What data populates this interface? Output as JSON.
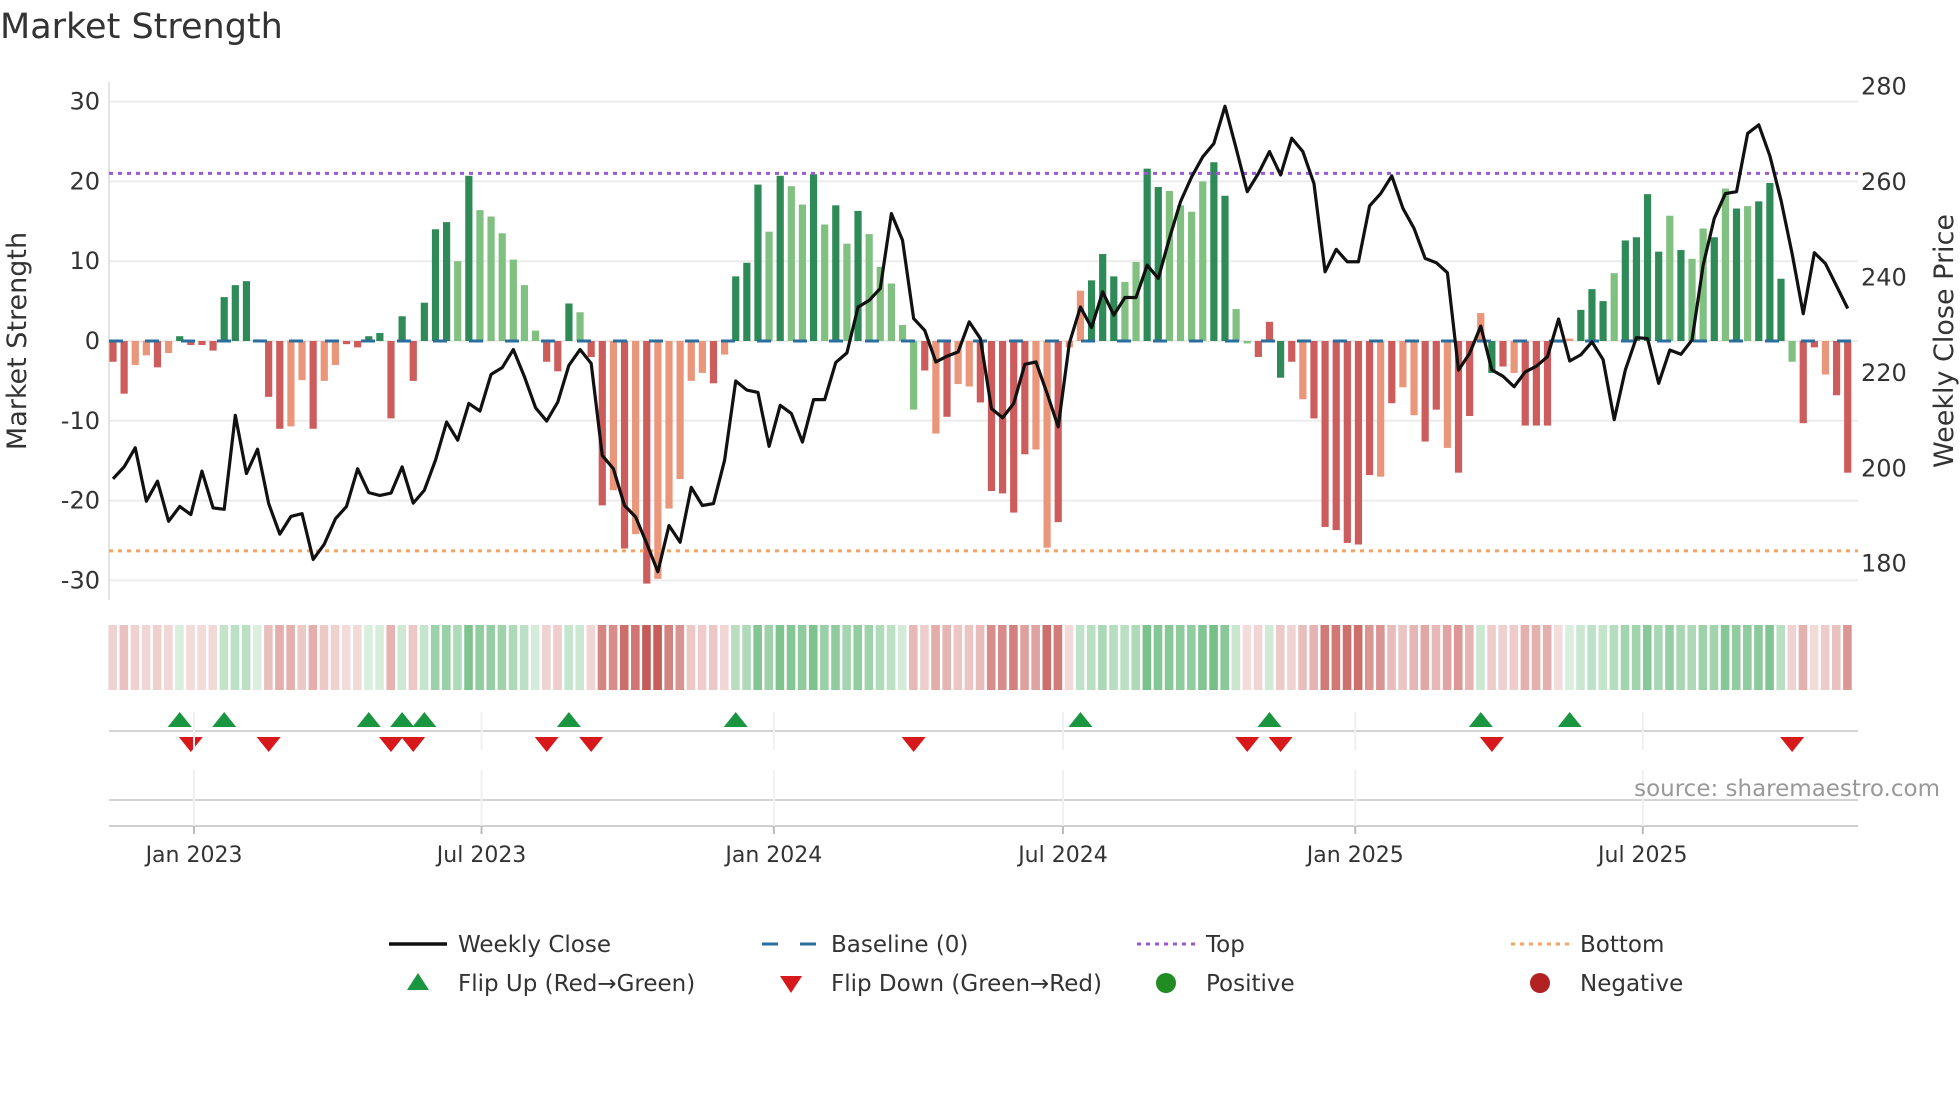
{
  "chart_data": {
    "type": "bar",
    "title": "Market Strength",
    "ylabel": "Market Strength",
    "y2label": "Weekly Close Price",
    "ylim": [
      -32.5,
      33
    ],
    "y2lim": [
      176,
      284
    ],
    "yticks": [
      30,
      20,
      10,
      0,
      -10,
      -20,
      -30
    ],
    "y2ticks": [
      280,
      260,
      240,
      220,
      200,
      180
    ],
    "x_start": "2022-11-11",
    "x_frequency": "weekly",
    "xtick_labels": [
      {
        "date": "2023-01-01",
        "label": "Jan 2023"
      },
      {
        "date": "2023-07-01",
        "label": "Jul 2023"
      },
      {
        "date": "2024-01-01",
        "label": "Jan 2024"
      },
      {
        "date": "2024-07-01",
        "label": "Jul 2024"
      },
      {
        "date": "2025-01-01",
        "label": "Jan 2025"
      },
      {
        "date": "2025-07-01",
        "label": "Jul 2025"
      }
    ],
    "top_level": 21,
    "bottom_level": -26.3,
    "baseline": 0,
    "strength": [
      -2.6,
      -6.6,
      -3,
      -1.8,
      -3.3,
      -1.5,
      0.6,
      -0.5,
      -0.5,
      -1.2,
      5.5,
      7,
      7.5,
      0.2,
      -7,
      -11,
      -10.7,
      -4.9,
      -11,
      -5,
      -3,
      -0.4,
      -0.8,
      0.6,
      1,
      -9.7,
      3.1,
      -5,
      4.8,
      14,
      14.9,
      10,
      20.7,
      16.4,
      15.6,
      13.5,
      10.2,
      7,
      1.3,
      -2.6,
      -3.8,
      4.7,
      3.6,
      -2,
      -20.6,
      -18.7,
      -26,
      -24.2,
      -30.4,
      -29.8,
      -21,
      -17.3,
      -5,
      -4,
      -5.3,
      -1.7,
      8.1,
      9.8,
      19.6,
      13.7,
      20.7,
      19.4,
      17.1,
      20.9,
      14.6,
      17,
      12.2,
      16.3,
      13.4,
      9.3,
      7.2,
      2,
      -8.6,
      -3.7,
      -11.6,
      -9.5,
      -5.4,
      -5.7,
      -7.7,
      -18.8,
      -19.1,
      -21.5,
      -14.2,
      -13.6,
      -25.9,
      -22.7,
      -0.8,
      6.3,
      7.6,
      10.9,
      8.1,
      7.4,
      9.9,
      21.6,
      19.3,
      18.8,
      17,
      16.2,
      20,
      22.4,
      18.2,
      4,
      -0.3,
      -2,
      2.4,
      -4.6,
      -2.6,
      -7.3,
      -9.7,
      -23.3,
      -23.7,
      -25.3,
      -25.5,
      -16.8,
      -17,
      -7.8,
      -5.8,
      -9.3,
      -12.6,
      -8.6,
      -13.4,
      -16.5,
      -9.4,
      3.5,
      -4,
      -3.2,
      -4,
      -10.6,
      -10.6,
      -10.6,
      -0.2,
      0.3,
      3.9,
      6.5,
      5,
      8.5,
      12.6,
      13,
      18.4,
      11.2,
      15.7,
      11.4,
      10.3,
      14.1,
      13,
      19.1,
      16.6,
      16.9,
      17.5,
      19.8,
      7.8,
      -2.6,
      -10.3,
      -0.8,
      -4.2,
      -6.8,
      -16.5
    ],
    "strength_shade": "RRrrRrGRRRGGGgRRrrRrrRRGGRGRGGGgGggggggRRGgRRrRrRrrrrrRrGGGgGggGgGgGgggggRrRrrRRRRRrrRrrGGGggGGggggGGggRRGRrRRRRRRrRrrRRrRRrGRrRRRRrGGGgGGGGgGggGgGgGGGgRRrRRR",
    "close": [
      197.8,
      200.3,
      204.3,
      193.1,
      197.3,
      188.9,
      192,
      190.3,
      199.4,
      191.7,
      191.4,
      211.1,
      198.9,
      204,
      192.6,
      186.2,
      189.9,
      190.5,
      180.9,
      184.1,
      189.4,
      192,
      199.9,
      194.9,
      194.3,
      194.8,
      200.3,
      192.7,
      195.4,
      201.7,
      209.7,
      205.9,
      213.6,
      212,
      219.7,
      221.1,
      224.9,
      219.2,
      212.7,
      209.9,
      213.9,
      221.6,
      224.9,
      222,
      202.7,
      199.9,
      192.2,
      189.8,
      184.2,
      178.3,
      188,
      184.5,
      196,
      192.2,
      192.6,
      201.7,
      218.3,
      216.4,
      215.9,
      204.6,
      213.2,
      211.5,
      205.5,
      214.4,
      214.4,
      222.2,
      224.2,
      233.8,
      235.2,
      237.7,
      253.4,
      247.8,
      231.4,
      228.9,
      222.3,
      223.5,
      224.4,
      230.7,
      227.2,
      212.5,
      210.6,
      213.6,
      221.8,
      222.3,
      215.7,
      208.7,
      226.2,
      233.8,
      229.5,
      237,
      232.1,
      235.8,
      235.8,
      242.6,
      239.8,
      248.2,
      255.9,
      261.1,
      265.3,
      268.1,
      275.9,
      267.1,
      258,
      261.8,
      266.4,
      261.5,
      269.2,
      266.4,
      259.7,
      241.2,
      245.9,
      243.3,
      243.3,
      255,
      257.6,
      261.3,
      254.5,
      250.3,
      244,
      243.1,
      241,
      220.6,
      224.1,
      229.8,
      220.6,
      219.3,
      217.1,
      220.2,
      221.4,
      223.4,
      231.3,
      222.5,
      223.8,
      226.5,
      222.8,
      210.2,
      220.6,
      227.4,
      227.2,
      217.8,
      224.8,
      223.9,
      226.9,
      242.6,
      252.4,
      257.6,
      258,
      270.2,
      272,
      265.5,
      256.2,
      245,
      232.4,
      245.2,
      242.9,
      238.2,
      233.5
    ],
    "legend": {
      "placement": "bottom",
      "items": [
        {
          "key": "close",
          "label": "Weekly Close"
        },
        {
          "key": "baseline",
          "label": "Baseline (0)"
        },
        {
          "key": "top",
          "label": "Top"
        },
        {
          "key": "bottom",
          "label": "Bottom"
        },
        {
          "key": "flip_up",
          "label": "Flip Up (Red→Green)"
        },
        {
          "key": "flip_down",
          "label": "Flip Down (Green→Red)"
        },
        {
          "key": "positive",
          "label": "Positive"
        },
        {
          "key": "negative",
          "label": "Negative"
        }
      ]
    },
    "source": "source: sharemaestro.com",
    "grid": true
  },
  "colors": {
    "strong_green": "#2e8b57",
    "weak_green": "#80c080",
    "strong_red": "#cd5c5c",
    "weak_red": "#e9967a",
    "close_line": "#111111",
    "baseline": "#2b6e9e",
    "top": "#9b59d6",
    "bottom": "#f4a460",
    "flip_up": "#1a9641",
    "flip_down": "#d7191c",
    "positive": "#228b22",
    "negative": "#b22222"
  }
}
